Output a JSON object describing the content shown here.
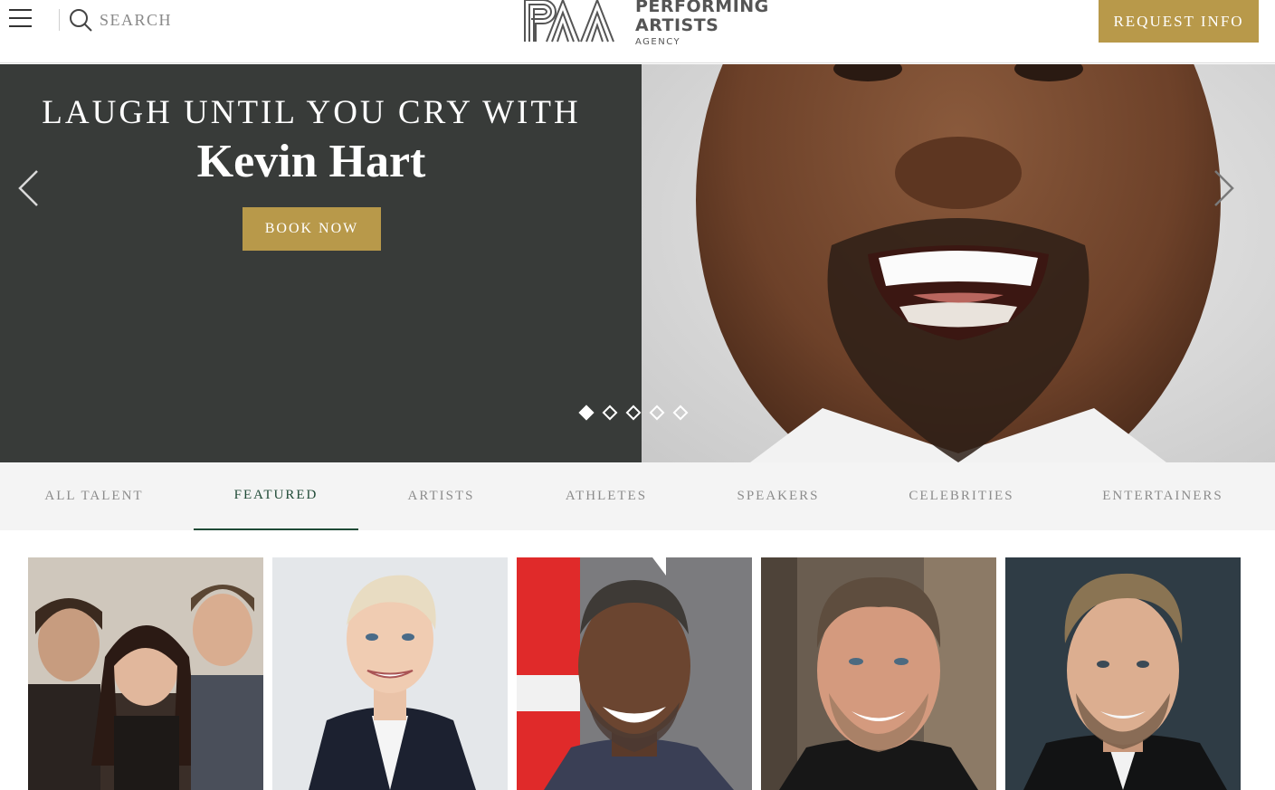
{
  "header": {
    "search_placeholder": "SEARCH",
    "logo_top": "PERFORMING",
    "logo_middle": "ARTISTS",
    "logo_bottom": "AGENCY",
    "request_label": "REQUEST INFO"
  },
  "hero": {
    "title": "LAUGH UNTIL YOU CRY WITH",
    "name": "Kevin Hart",
    "book_label": "BOOK NOW",
    "slide_count": 5,
    "active_slide": 1
  },
  "tabs": [
    {
      "label": "ALL TALENT",
      "active": false
    },
    {
      "label": "FEATURED",
      "active": true
    },
    {
      "label": "ARTISTS",
      "active": false
    },
    {
      "label": "ATHLETES",
      "active": false
    },
    {
      "label": "SPEAKERS",
      "active": false
    },
    {
      "label": "CELEBRITIES",
      "active": false
    },
    {
      "label": "ENTERTAINERS",
      "active": false
    }
  ],
  "colors": {
    "gold": "#b8994a",
    "hero_dark": "#383b39",
    "tab_active": "#1f4a36",
    "tab_bar_bg": "#f4f4f4"
  },
  "icons": [
    "menu-icon",
    "search-icon",
    "chevron-left-icon",
    "chevron-right-icon",
    "slide-dot-icon"
  ]
}
